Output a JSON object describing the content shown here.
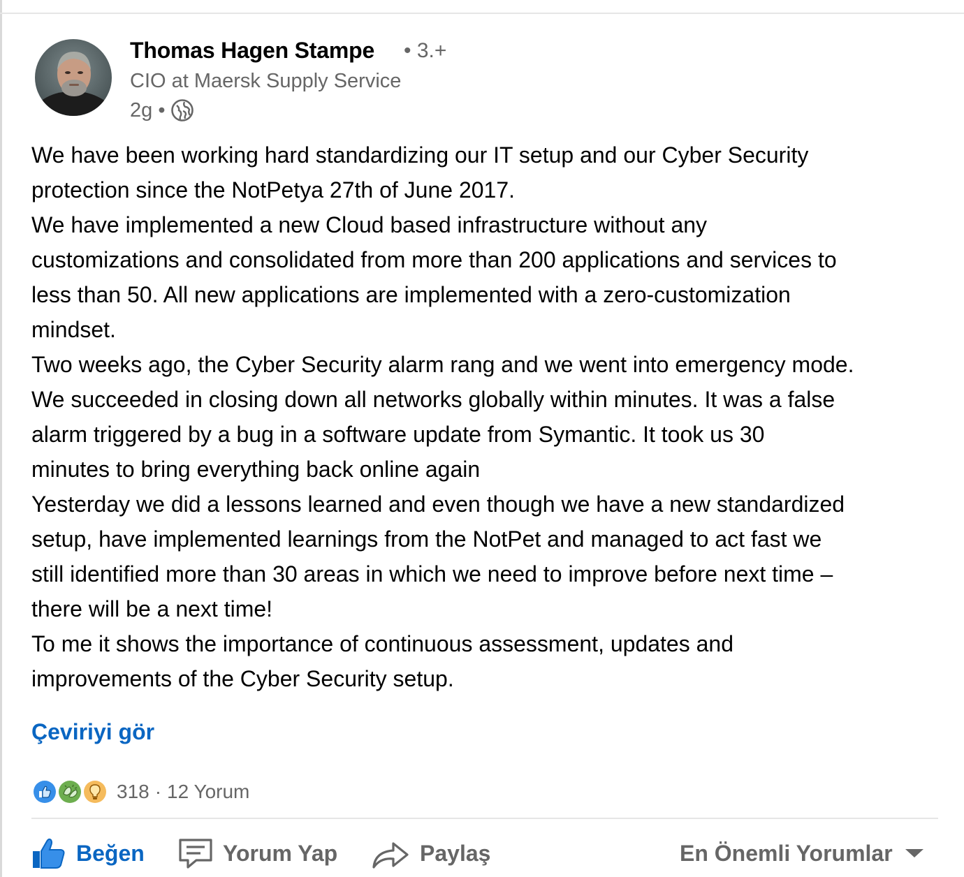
{
  "post": {
    "author": {
      "name": "Thomas Hagen Stampe",
      "degree": "• 3.+",
      "headline": "CIO at Maersk Supply Service",
      "time": "2g •"
    },
    "icons": {
      "visibility": "globe-icon",
      "avatar": "profile-photo"
    },
    "body": [
      "We have been working hard standardizing our IT setup and our Cyber Security",
      "protection since the NotPetya 27th of June 2017.",
      "We have implemented a new Cloud based infrastructure without any",
      "customizations and consolidated from more than 200 applications and services to",
      "less than 50. All new applications are implemented with a zero-customization",
      "mindset.",
      "Two weeks ago, the Cyber Security alarm rang and we went into emergency mode.",
      "We succeeded in closing down all networks globally within minutes. It was a false",
      "alarm triggered by a bug in a software update from Symantic. It took us 30",
      "minutes to bring everything back online again",
      "Yesterday we did a lessons learned and even though we have a new standardized",
      "setup, have implemented learnings from the NotPet and managed to act fast we",
      "still identified more than 30 areas in which we need to improve before next time –",
      "there will be a next time!",
      "To me it shows the importance of continuous assessment, updates and",
      "improvements of the Cyber Security setup."
    ],
    "translate_label": "Çeviriyi gör"
  },
  "social": {
    "reactions": [
      "like-icon",
      "celebrate-icon",
      "insightful-icon"
    ],
    "reaction_count": "318",
    "separator": "·",
    "comment_count": "12 Yorum"
  },
  "actions": {
    "like_label": "Beğen",
    "comment_label": "Yorum Yap",
    "share_label": "Paylaş",
    "sort_label": "En Önemli Yorumlar"
  },
  "colors": {
    "accent": "#0a66c2",
    "secondary_text": "#666666",
    "like_reaction": "#378fe9",
    "celebrate_reaction": "#44712e",
    "insightful_reaction": "#f5bb5c"
  }
}
